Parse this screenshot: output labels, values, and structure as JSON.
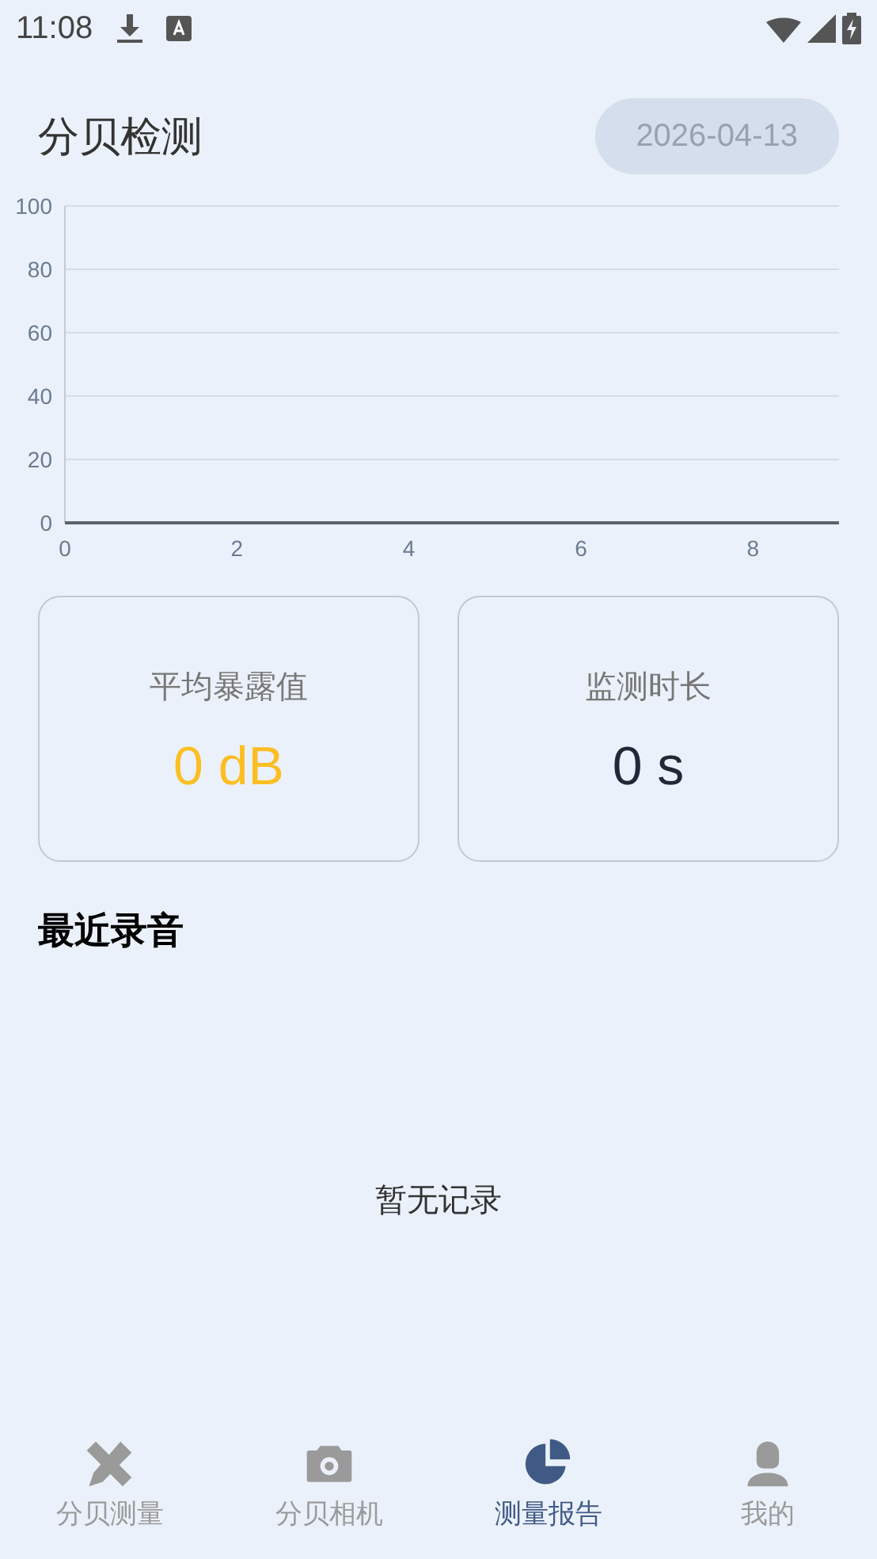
{
  "status_bar": {
    "time": "11:08"
  },
  "header": {
    "title": "分贝检测",
    "date": "2026-04-13"
  },
  "chart": {
    "chart_data": {
      "type": "line",
      "xlim": [
        0,
        9
      ],
      "ylim": [
        0,
        100
      ],
      "xticks": [
        0,
        2,
        4,
        6,
        8
      ],
      "yticks": [
        0,
        20,
        40,
        60,
        80,
        100
      ],
      "grid": true
    }
  },
  "cards": [
    {
      "label": "平均暴露值",
      "value": "0 dB",
      "color": "#fbbf24"
    },
    {
      "label": "监测时长",
      "value": "0 s",
      "color": "#1f2937"
    }
  ],
  "recent": {
    "title": "最近录音",
    "empty_text": "暂无记录"
  },
  "bottom_nav": [
    {
      "label": "分贝测量",
      "kind": "ruler-pencil",
      "selected": false
    },
    {
      "label": "分贝相机",
      "kind": "camera",
      "selected": false
    },
    {
      "label": "测量报告",
      "kind": "pie",
      "selected": true
    },
    {
      "label": "我的",
      "kind": "person",
      "selected": false
    }
  ]
}
